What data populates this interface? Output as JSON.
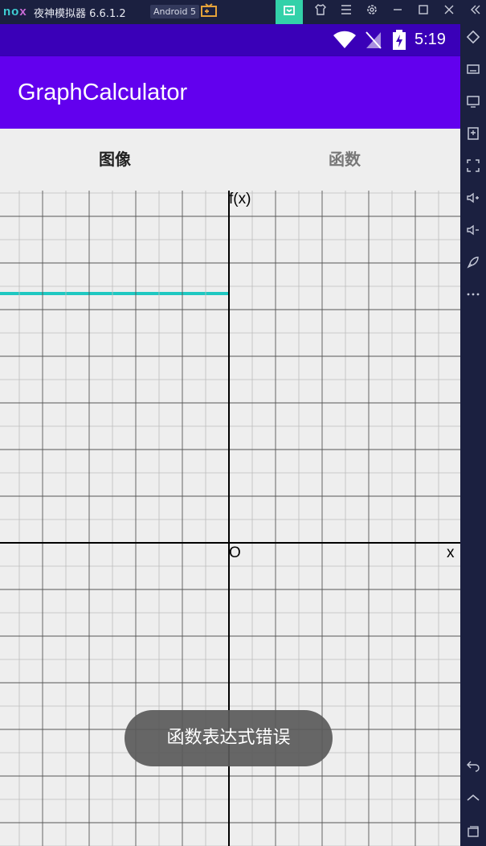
{
  "emulator": {
    "logo": "nox",
    "app_name": "夜神模拟器 6.6.1.2",
    "android_badge": "Android 5",
    "window_controls": [
      "gift-icon",
      "tshirt-icon",
      "menu-icon",
      "settings-icon",
      "minimize-icon",
      "maximize-icon",
      "close-icon",
      "collapse-icon"
    ],
    "sidebar_tools": [
      "rotate-icon",
      "keyboard-icon",
      "screen-icon",
      "apk-icon",
      "fullscreen-icon",
      "volume-up-icon",
      "volume-down-icon",
      "rocket-icon",
      "more-icon",
      "back-icon",
      "home-icon",
      "recents-icon"
    ]
  },
  "status_bar": {
    "time": "5:19"
  },
  "app_bar": {
    "title": "GraphCalculator"
  },
  "tabs": [
    {
      "label": "图像",
      "selected": true
    },
    {
      "label": "函数",
      "selected": false
    }
  ],
  "graph": {
    "y_axis_label": "f(x)",
    "x_axis_label": "x",
    "origin_label": "O",
    "grid": true
  },
  "toast": {
    "message": "函数表达式错误"
  },
  "colors": {
    "status_bar": "#3a00b8",
    "app_bar": "#6200ee",
    "tab_indicator": "#1fc8c1",
    "emulator_chrome": "#1b2040"
  }
}
